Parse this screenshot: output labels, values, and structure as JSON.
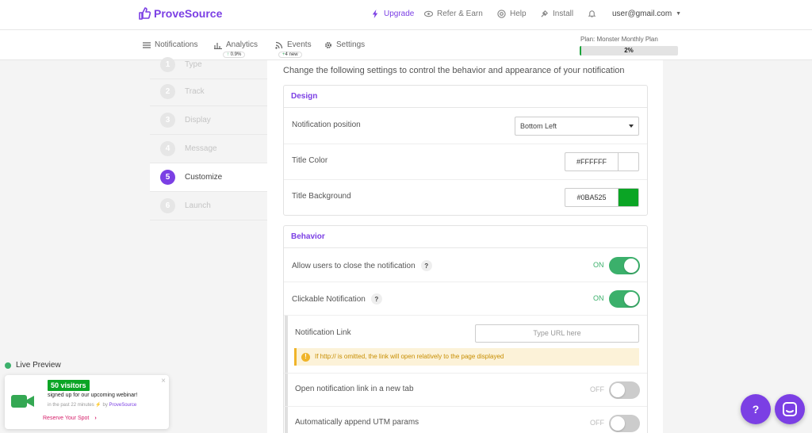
{
  "brand": {
    "name": "ProveSource"
  },
  "topnav": {
    "upgrade": "Upgrade",
    "refer": "Refer & Earn",
    "help": "Help",
    "install": "Install",
    "user": "user@gmail.com"
  },
  "subnav": {
    "notifications": "Notifications",
    "analytics": "Analytics",
    "analytics_badge": "0.9%",
    "events": "Events",
    "events_badge": "4 new",
    "settings": "Settings",
    "plan_label": "Plan: Monster Monthly Plan",
    "plan_progress_text": "2%",
    "plan_progress": 0.02
  },
  "steps": [
    {
      "num": "1",
      "label": "Type"
    },
    {
      "num": "2",
      "label": "Track"
    },
    {
      "num": "3",
      "label": "Display"
    },
    {
      "num": "4",
      "label": "Message"
    },
    {
      "num": "5",
      "label": "Customize"
    },
    {
      "num": "6",
      "label": "Launch"
    }
  ],
  "main": {
    "intro": "Change the following settings to control the behavior and appearance of your notification",
    "design": {
      "title": "Design",
      "position_label": "Notification position",
      "position_value": "Bottom Left",
      "title_color_label": "Title Color",
      "title_color_value": "#FFFFFF",
      "title_bg_label": "Title Background",
      "title_bg_value": "#0BA525"
    },
    "behavior": {
      "title": "Behavior",
      "allow_close_label": "Allow users to close the notification",
      "allow_close_state": "ON",
      "clickable_label": "Clickable Notification",
      "clickable_state": "ON",
      "link_label": "Notification Link",
      "link_placeholder": "Type URL here",
      "warning": "If http:// is omitted, the link will open relatively to the page displayed",
      "new_tab_label": "Open notification link in a new tab",
      "new_tab_state": "OFF",
      "utm_label": "Automatically append UTM params",
      "utm_state": "OFF"
    }
  },
  "preview": {
    "label": "Live Preview",
    "badge": "50 visitors",
    "line1": "signed up for our upcoming webinar!",
    "line2": "in the past 22 minutes",
    "by": "by",
    "by_brand": "ProveSource",
    "cta": "Reserve Your Spot",
    "close": "×"
  },
  "fab": {
    "help": "?"
  },
  "colors": {
    "accent": "#7b3fe4",
    "green": "#3bb06b",
    "title_bg": "#0BA525",
    "title_color": "#FFFFFF"
  }
}
